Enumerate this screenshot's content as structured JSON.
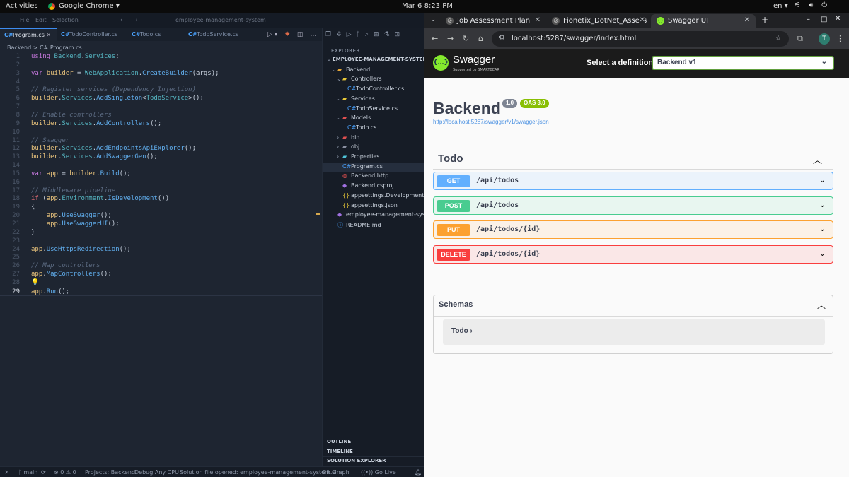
{
  "topbar": {
    "activities": "Activities",
    "app": "Google Chrome ▾",
    "clock": "Mar 6  8:23 PM",
    "lang": "en ▾"
  },
  "vscode": {
    "title_menu": [
      "File",
      "Edit",
      "Selection",
      "employee-management-system"
    ],
    "tabs": [
      {
        "label": "Program.cs",
        "active": true
      },
      {
        "label": "TodoController.cs",
        "active": false
      },
      {
        "label": "Todo.cs",
        "active": false
      },
      {
        "label": "TodoService.cs",
        "active": false
      }
    ],
    "breadcrumb": "Backend  >  C# Program.cs",
    "code_lines": [
      {
        "n": "1",
        "segs": [
          [
            "kw",
            "using "
          ],
          [
            "ty",
            "Backend"
          ],
          [
            "",
            "."
          ],
          [
            "ty",
            "Services"
          ],
          [
            "",
            ";"
          ]
        ]
      },
      {
        "n": "2",
        "segs": []
      },
      {
        "n": "3",
        "segs": [
          [
            "kw",
            "var "
          ],
          [
            "var",
            "builder"
          ],
          [
            "",
            " = "
          ],
          [
            "ty",
            "WebApplication"
          ],
          [
            "",
            "."
          ],
          [
            "fn",
            "CreateBuilder"
          ],
          [
            "",
            "(args);"
          ]
        ]
      },
      {
        "n": "4",
        "segs": []
      },
      {
        "n": "5",
        "segs": [
          [
            "cm",
            "// Register services (Dependency Injection)"
          ]
        ]
      },
      {
        "n": "6",
        "segs": [
          [
            "var",
            "builder"
          ],
          [
            "",
            "."
          ],
          [
            "ty",
            "Services"
          ],
          [
            "",
            "."
          ],
          [
            "fn",
            "AddSingleton"
          ],
          [
            "",
            "<"
          ],
          [
            "ty",
            "TodoService"
          ],
          [
            "",
            ">();"
          ]
        ]
      },
      {
        "n": "7",
        "segs": []
      },
      {
        "n": "8",
        "segs": [
          [
            "cm",
            "// Enable controllers"
          ]
        ]
      },
      {
        "n": "9",
        "segs": [
          [
            "var",
            "builder"
          ],
          [
            "",
            "."
          ],
          [
            "ty",
            "Services"
          ],
          [
            "",
            "."
          ],
          [
            "fn",
            "AddControllers"
          ],
          [
            "",
            "();"
          ]
        ]
      },
      {
        "n": "10",
        "segs": []
      },
      {
        "n": "11",
        "segs": [
          [
            "cm",
            "// Swagger"
          ]
        ]
      },
      {
        "n": "12",
        "segs": [
          [
            "var",
            "builder"
          ],
          [
            "",
            "."
          ],
          [
            "ty",
            "Services"
          ],
          [
            "",
            "."
          ],
          [
            "fn",
            "AddEndpointsApiExplorer"
          ],
          [
            "",
            "();"
          ]
        ]
      },
      {
        "n": "13",
        "segs": [
          [
            "var",
            "builder"
          ],
          [
            "",
            "."
          ],
          [
            "ty",
            "Services"
          ],
          [
            "",
            "."
          ],
          [
            "fn",
            "AddSwaggerGen"
          ],
          [
            "",
            "();"
          ]
        ]
      },
      {
        "n": "14",
        "segs": []
      },
      {
        "n": "15",
        "segs": [
          [
            "kw",
            "var "
          ],
          [
            "var",
            "app"
          ],
          [
            "",
            " = "
          ],
          [
            "var",
            "builder"
          ],
          [
            "",
            "."
          ],
          [
            "fn",
            "Build"
          ],
          [
            "",
            "();"
          ]
        ]
      },
      {
        "n": "16",
        "segs": []
      },
      {
        "n": "17",
        "segs": [
          [
            "cm",
            "// Middleware pipeline"
          ]
        ]
      },
      {
        "n": "18",
        "segs": [
          [
            "kw2",
            "if "
          ],
          [
            "",
            "("
          ],
          [
            "var",
            "app"
          ],
          [
            "",
            "."
          ],
          [
            "ty",
            "Environment"
          ],
          [
            "",
            "."
          ],
          [
            "fn",
            "IsDevelopment"
          ],
          [
            "",
            "())"
          ]
        ]
      },
      {
        "n": "19",
        "segs": [
          [
            "",
            "{"
          ]
        ]
      },
      {
        "n": "20",
        "segs": [
          [
            "",
            "    "
          ],
          [
            "var",
            "app"
          ],
          [
            "",
            "."
          ],
          [
            "fn",
            "UseSwagger"
          ],
          [
            "",
            "();"
          ]
        ]
      },
      {
        "n": "21",
        "segs": [
          [
            "",
            "    "
          ],
          [
            "var",
            "app"
          ],
          [
            "",
            "."
          ],
          [
            "fn",
            "UseSwaggerUI"
          ],
          [
            "",
            "();"
          ]
        ]
      },
      {
        "n": "22",
        "segs": [
          [
            "",
            "}"
          ]
        ]
      },
      {
        "n": "23",
        "segs": []
      },
      {
        "n": "24",
        "segs": [
          [
            "var",
            "app"
          ],
          [
            "",
            "."
          ],
          [
            "fn",
            "UseHttpsRedirection"
          ],
          [
            "",
            "();"
          ]
        ]
      },
      {
        "n": "25",
        "segs": []
      },
      {
        "n": "26",
        "segs": [
          [
            "cm",
            "// Map controllers"
          ]
        ]
      },
      {
        "n": "27",
        "segs": [
          [
            "var",
            "app"
          ],
          [
            "",
            "."
          ],
          [
            "fn",
            "MapControllers"
          ],
          [
            "",
            "();"
          ]
        ]
      },
      {
        "n": "28",
        "segs": [
          [
            "var",
            "💡"
          ]
        ]
      },
      {
        "n": "29",
        "segs": [
          [
            "var",
            "app"
          ],
          [
            "",
            "."
          ],
          [
            "fn",
            "Run"
          ],
          [
            "",
            "();"
          ]
        ],
        "current": true
      }
    ],
    "explorer": {
      "heading": "EXPLORER",
      "items": [
        {
          "label": "EMPLOYEE-MANAGEMENT-SYSTEM",
          "indent": 0,
          "chev": "⌄",
          "icon": "",
          "bold": true
        },
        {
          "label": "Backend",
          "indent": 1,
          "chev": "⌄",
          "icon": "▰",
          "color": "#e8a838"
        },
        {
          "label": "Controllers",
          "indent": 2,
          "chev": "⌄",
          "icon": "▰",
          "color": "#e8c838"
        },
        {
          "label": "TodoController.cs",
          "indent": 3,
          "chev": "",
          "icon": "C#",
          "color": "#4aa3ff"
        },
        {
          "label": "Services",
          "indent": 2,
          "chev": "⌄",
          "icon": "▰",
          "color": "#e8c838"
        },
        {
          "label": "TodoService.cs",
          "indent": 3,
          "chev": "",
          "icon": "C#",
          "color": "#4aa3ff"
        },
        {
          "label": "Models",
          "indent": 2,
          "chev": "⌄",
          "icon": "▰",
          "color": "#e05050"
        },
        {
          "label": "Todo.cs",
          "indent": 3,
          "chev": "",
          "icon": "C#",
          "color": "#4aa3ff"
        },
        {
          "label": "bin",
          "indent": 2,
          "chev": "›",
          "icon": "▰",
          "color": "#e05050"
        },
        {
          "label": "obj",
          "indent": 2,
          "chev": "›",
          "icon": "▰",
          "color": "#8a8fa0"
        },
        {
          "label": "Properties",
          "indent": 2,
          "chev": "›",
          "icon": "▰",
          "color": "#4fc3d8"
        },
        {
          "label": "Program.cs",
          "indent": 2,
          "chev": "",
          "icon": "C#",
          "color": "#4aa3ff",
          "selected": true
        },
        {
          "label": "Backend.http",
          "indent": 2,
          "chev": "",
          "icon": "◍",
          "color": "#e05050"
        },
        {
          "label": "Backend.csproj",
          "indent": 2,
          "chev": "",
          "icon": "◆",
          "color": "#a070e0"
        },
        {
          "label": "appsettings.Development.j...",
          "indent": 2,
          "chev": "",
          "icon": "{}",
          "color": "#e8c838"
        },
        {
          "label": "appsettings.json",
          "indent": 2,
          "chev": "",
          "icon": "{}",
          "color": "#e8c838"
        },
        {
          "label": "employee-management-syst...",
          "indent": 1,
          "chev": "",
          "icon": "◆",
          "color": "#a070e0"
        },
        {
          "label": "README.md",
          "indent": 1,
          "chev": "",
          "icon": "ⓘ",
          "color": "#4aa3ff"
        }
      ],
      "sections": [
        "OUTLINE",
        "TIMELINE",
        "SOLUTION EXPLORER"
      ]
    },
    "status": [
      "✕",
      "ᚴ main",
      "⟳",
      "⊗ 0 ⚠ 0",
      "Projects: Backend",
      "Debug Any CPU",
      "Solution file opened: employee-management-system.sln",
      "Git Graph",
      "((•)) Go Live"
    ]
  },
  "chrome": {
    "tabs": [
      {
        "label": "Job Assessment Plan",
        "fav": "◎",
        "fav_bg": "#555"
      },
      {
        "label": "Fionetix_DotNet_Assess",
        "fav": "◎",
        "fav_bg": "#555"
      },
      {
        "label": "Swagger UI",
        "fav": "{}",
        "fav_bg": "#85ea2d",
        "active": true
      }
    ],
    "url": "localhost:5287/swagger/index.html",
    "avatar": "T"
  },
  "swagger": {
    "brand": "Swagger",
    "brand_sub": "Supported by SMARTBEAR",
    "definition_label": "Select a definition",
    "definition_value": "Backend v1",
    "title": "Backend",
    "version": "1.0",
    "oas": "OAS 3.0",
    "spec_url": "http://localhost:5287/swagger/v1/swagger.json",
    "tag": "Todo",
    "operations": [
      {
        "method": "GET",
        "path": "/api/todos",
        "color": "#61affe",
        "bg": "#ebf3fb",
        "border": "#61affe"
      },
      {
        "method": "POST",
        "path": "/api/todos",
        "color": "#49cc90",
        "bg": "#e8f6f0",
        "border": "#49cc90"
      },
      {
        "method": "PUT",
        "path": "/api/todos/{id}",
        "color": "#fca130",
        "bg": "#fbf1e6",
        "border": "#fca130"
      },
      {
        "method": "DELETE",
        "path": "/api/todos/{id}",
        "color": "#f93e3e",
        "bg": "#fae7e7",
        "border": "#f93e3e"
      }
    ],
    "schemas_label": "Schemas",
    "schema_model": "Todo  ›"
  }
}
